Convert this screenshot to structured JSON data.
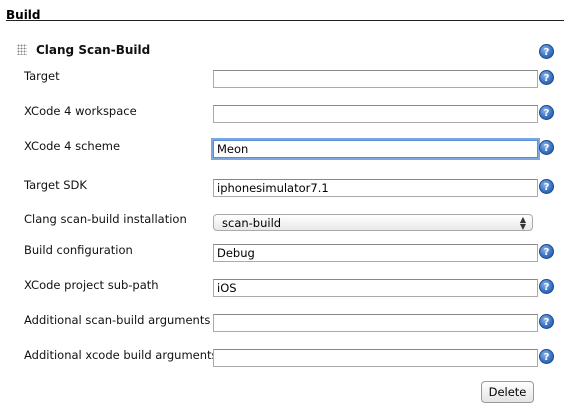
{
  "section": {
    "title": "Build"
  },
  "builder": {
    "title": "Clang Scan-Build",
    "help_glyph": "?"
  },
  "fields": [
    {
      "name": "target",
      "label": "Target",
      "value": "",
      "help_glyph": "?"
    },
    {
      "name": "xcode4-workspace",
      "label": "XCode 4 workspace",
      "value": "",
      "help_glyph": "?"
    },
    {
      "name": "xcode4-scheme",
      "label": "XCode 4 scheme",
      "value": "Meon",
      "help_glyph": "?",
      "focused": true
    },
    {
      "name": "target-sdk",
      "label": "Target SDK",
      "value": "iphonesimulator7.1",
      "help_glyph": "?"
    },
    {
      "name": "clang-installation",
      "label": "Clang scan-build installation",
      "type": "select",
      "value": "scan-build"
    },
    {
      "name": "build-configuration",
      "label": "Build configuration",
      "value": "Debug",
      "help_glyph": "?"
    },
    {
      "name": "xcode-project-subpath",
      "label": "XCode project sub-path",
      "value": "iOS",
      "help_glyph": "?"
    },
    {
      "name": "additional-scanbuild-args",
      "label": "Additional scan-build arguments",
      "value": "",
      "help_glyph": "?"
    },
    {
      "name": "additional-xcodebuild-args",
      "label": "Additional xcode build arguments",
      "value": "",
      "help_glyph": "?"
    }
  ],
  "actions": {
    "delete_label": "Delete"
  },
  "colors": {
    "help_icon": "#3a74c4",
    "focus_ring": "#7aa7e0"
  }
}
